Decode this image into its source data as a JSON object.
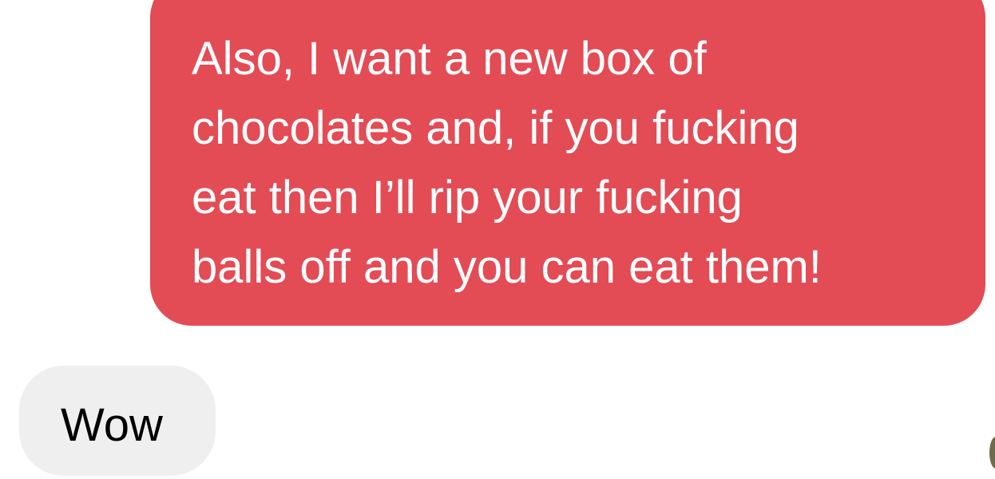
{
  "messages": {
    "outgoing": {
      "lines": [
        "Also, I want a new box of",
        "chocolates and, if you fucking",
        "eat then I’ll rip your fucking",
        "balls off and you can eat them!"
      ]
    },
    "incoming": {
      "text": "Wow"
    }
  },
  "colors": {
    "outgoing_bubble": "#e34c55",
    "incoming_bubble": "#efefef",
    "outgoing_text": "#ffffff",
    "incoming_text": "#000000"
  }
}
